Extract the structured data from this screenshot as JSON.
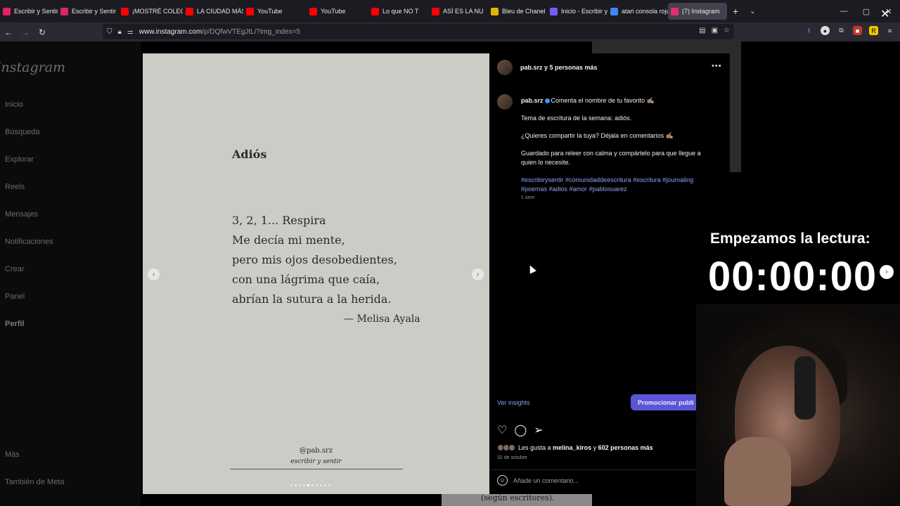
{
  "browser": {
    "tabs": [
      {
        "label": "Escribir y Sentir - ",
        "favicon": "sk",
        "color": "#e0245e"
      },
      {
        "label": "Escribir y Sentir",
        "favicon": "sk",
        "color": "#e0245e"
      },
      {
        "label": "¡MOSTRÉ COLECC",
        "favicon": "youtube-icon",
        "color": "#ff0000"
      },
      {
        "label": "LA CIUDAD MÁS",
        "favicon": "youtube-icon",
        "color": "#ff0000"
      },
      {
        "label": "YouTube",
        "favicon": "youtube-icon",
        "color": "#ff0000"
      },
      {
        "label": "YouTube",
        "favicon": "youtube-icon",
        "color": "#ff0000"
      },
      {
        "label": "Lo que NO T",
        "favicon": "youtube-icon",
        "color": "#ff0000"
      },
      {
        "label": "ASÍ ES LA NU",
        "favicon": "youtube-icon",
        "color": "#ff0000"
      },
      {
        "label": "Bleu de Chanel P",
        "favicon": "page-icon",
        "color": "#e8b200"
      },
      {
        "label": "Inicio - Escribir y",
        "favicon": "page-icon",
        "color": "#7a5cf0"
      },
      {
        "label": "atari consola roja",
        "favicon": "google-icon",
        "color": "#4285f4"
      },
      {
        "label": "(7) Instagram",
        "favicon": "instagram-icon",
        "color": "#e1306c",
        "active": true
      }
    ],
    "url_host": "www.instagram.com",
    "url_path": "/p/DQfwVTEgJtL/?img_index=5"
  },
  "sidebar": {
    "logo": "Instagram",
    "items": [
      "Inicio",
      "Búsqueda",
      "Explorar",
      "Reels",
      "Mensajes",
      "Notificaciones",
      "Crear",
      "Panel",
      "Perfil",
      "Más",
      "También de Meta"
    ]
  },
  "post": {
    "image": {
      "title": "Adiós",
      "lines": [
        "3, 2, 1... Respira",
        "Me decía mi mente,",
        "pero mis ojos desobedientes,",
        "con una lágrima que caía,",
        "abrían la sutura a la herida."
      ],
      "author": "— Melisa Ayala",
      "handle": "@pab.srz",
      "subtitle": "escribir y sentir",
      "dot_count": 10,
      "active_dot": 4
    },
    "header_name": "pab.srz y 5 personas más",
    "caption": {
      "username": "pab.srz",
      "first_line": "Comenta el nombre de tu favorito ✍🏽",
      "p1": "Tema de escritura de la semana: adiós.",
      "p2": "¿Quieres compartir la tuya? Déjala en comentarios ✍🏽",
      "p3": "Guardado para releer con calma y compártelo para que llegue a quien lo necesite.",
      "tags": "#escribirysentir #comunidaddeescritura #escritura #journaling #poemas #adios #amor #pablosuarez"
    },
    "time_ago": "1 sem",
    "insights": "Ver insights",
    "promote": "Promocionar publi",
    "likes_prefix": "Les gusta a ",
    "likes_user": "melina_kiros",
    "likes_suffix": " y ",
    "likes_count": "602 personas más",
    "date": "31 de octubre",
    "comment_placeholder": "Añade un comentario...",
    "background_text": "(según escritores)."
  },
  "overlay": {
    "title": "Empezamos la lectura:",
    "timer": "00:00:00"
  }
}
